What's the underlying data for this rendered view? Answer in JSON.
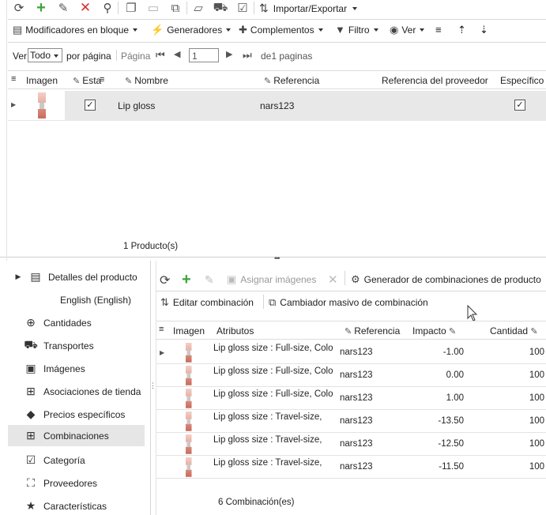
{
  "toolbar1": {
    "import_export_label": "Importar/Exportar"
  },
  "toolbar2": {
    "bulk_modifiers_label": "Modificadores en bloque",
    "generators_label": "Generadores",
    "addons_label": "Complementos",
    "filter_label": "Filtro",
    "view_label": "Ver"
  },
  "pager": {
    "view_label": "Ver",
    "per_page_value": "Todo",
    "per_page_label": "por página",
    "page_label": "Página",
    "page_value": "1",
    "of_pages_label": "de1 paginas"
  },
  "product_grid": {
    "columns": [
      "Imagen",
      "Esta",
      "Nombre",
      "Referencia",
      "Referencia del proveedor",
      "Específico"
    ],
    "rows": [
      {
        "enabled": "✓",
        "name": "Lip gloss",
        "reference": "nars123",
        "specific": "✓"
      }
    ],
    "footer": "1 Producto(s)"
  },
  "left_nav": {
    "items": [
      {
        "label": "Detalles del producto",
        "icon": "details-icon"
      },
      {
        "label": "English (English)",
        "icon": ""
      },
      {
        "label": "Cantidades",
        "icon": "quantities-icon"
      },
      {
        "label": "Transportes",
        "icon": "truck-icon"
      },
      {
        "label": "Imágenes",
        "icon": "image-icon"
      },
      {
        "label": "Asociaciones de tienda",
        "icon": "store-icon"
      },
      {
        "label": "Precios específicos",
        "icon": "price-tag-icon"
      },
      {
        "label": "Combinaciones",
        "icon": "combinations-icon"
      },
      {
        "label": "Categoría",
        "icon": "category-icon"
      },
      {
        "label": "Proveedores",
        "icon": "suppliers-icon"
      },
      {
        "label": "Características",
        "icon": "star-icon"
      }
    ]
  },
  "comb_toolbar": {
    "assign_images_label": "Asignar imágenes",
    "generator_label": "Generador de combinaciones de producto",
    "edit_label": "Editar combinación",
    "mass_change_label": "Cambiador masivo de combinación"
  },
  "comb_grid": {
    "columns": [
      "Imagen",
      "Atributos",
      "Referencia",
      "Impacto",
      "Cantidad"
    ],
    "rows": [
      {
        "attributes": "Lip gloss size : Full-size, Color",
        "reference": "nars123",
        "impact": "-1.00",
        "quantity": "100"
      },
      {
        "attributes": "Lip gloss size : Full-size, Color",
        "reference": "nars123",
        "impact": "0.00",
        "quantity": "100"
      },
      {
        "attributes": "Lip gloss size : Full-size, Color",
        "reference": "nars123",
        "impact": "1.00",
        "quantity": "100"
      },
      {
        "attributes": "Lip gloss size : Travel-size,",
        "reference": "nars123",
        "impact": "-13.50",
        "quantity": "100"
      },
      {
        "attributes": "Lip gloss size : Travel-size,",
        "reference": "nars123",
        "impact": "-12.50",
        "quantity": "100"
      },
      {
        "attributes": "Lip gloss size : Travel-size,",
        "reference": "nars123",
        "impact": "-11.50",
        "quantity": "100"
      }
    ],
    "footer": "6 Combinación(es)"
  },
  "colors": {
    "accent_green": "#3aa53a",
    "accent_red": "#d93030",
    "selection_gray": "#e8e8e8"
  }
}
